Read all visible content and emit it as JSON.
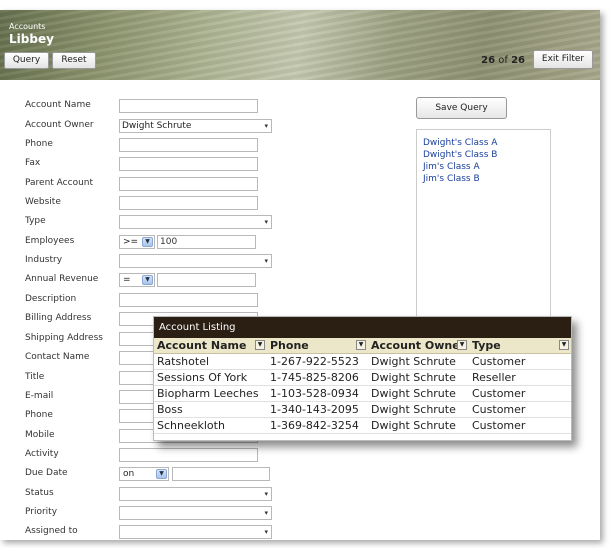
{
  "header": {
    "subtitle": "Accounts",
    "title": "Libbey",
    "query_label": "Query",
    "reset_label": "Reset",
    "record_current": "26",
    "record_of": "of",
    "record_total": "26",
    "exit_filter_label": "Exit Filter"
  },
  "form": {
    "account_name": {
      "label": "Account Name",
      "value": ""
    },
    "account_owner": {
      "label": "Account Owner",
      "value": "Dwight Schrute"
    },
    "phone": {
      "label": "Phone",
      "value": ""
    },
    "fax": {
      "label": "Fax",
      "value": ""
    },
    "parent_account": {
      "label": "Parent Account",
      "value": ""
    },
    "website": {
      "label": "Website",
      "value": ""
    },
    "type": {
      "label": "Type",
      "value": ""
    },
    "employees": {
      "label": "Employees",
      "operator": ">=",
      "value": "100"
    },
    "industry": {
      "label": "Industry",
      "value": ""
    },
    "annual_revenue": {
      "label": "Annual Revenue",
      "operator": "=",
      "value": ""
    },
    "description": {
      "label": "Description",
      "value": ""
    },
    "billing_address": {
      "label": "Billing Address"
    },
    "shipping_address": {
      "label": "Shipping Address"
    },
    "contact_name": {
      "label": "Contact Name"
    },
    "title": {
      "label": "Title"
    },
    "email": {
      "label": "E-mail"
    },
    "phone2": {
      "label": "Phone"
    },
    "mobile": {
      "label": "Mobile"
    },
    "activity": {
      "label": "Activity",
      "value": ""
    },
    "due_date": {
      "label": "Due Date",
      "operator": "on",
      "value": ""
    },
    "status": {
      "label": "Status",
      "value": ""
    },
    "priority": {
      "label": "Priority",
      "value": ""
    },
    "assigned_to": {
      "label": "Assigned to",
      "value": ""
    }
  },
  "saved_queries": {
    "save_label": "Save Query",
    "items": [
      "Dwight's Class A",
      "Dwight's Class B",
      "Jim's Class A",
      "Jim's Class B"
    ]
  },
  "listing": {
    "title": "Account Listing",
    "columns": [
      "Account Name",
      "Phone",
      "Account Owner",
      "Type"
    ],
    "rows": [
      [
        "Ratshotel",
        "1-267-922-5523",
        "Dwight Schrute",
        "Customer"
      ],
      [
        "Sessions Of York",
        "1-745-825-8206",
        "Dwight Schrute",
        "Reseller"
      ],
      [
        "Biopharm Leeches",
        "1-103-528-0934",
        "Dwight Schrute",
        "Customer"
      ],
      [
        "Boss",
        "1-340-143-2095",
        "Dwight Schrute",
        "Customer"
      ],
      [
        "Schneekloth",
        "1-369-842-3254",
        "Dwight Schrute",
        "Customer"
      ]
    ]
  },
  "icons": {
    "dropdown": "chevron-down-icon",
    "column_filter": "filter-icon"
  },
  "colors": {
    "listing_title_bg": "#2b1f14",
    "grid_header_bg": "#ece7c8",
    "link": "#1a3f9c"
  }
}
